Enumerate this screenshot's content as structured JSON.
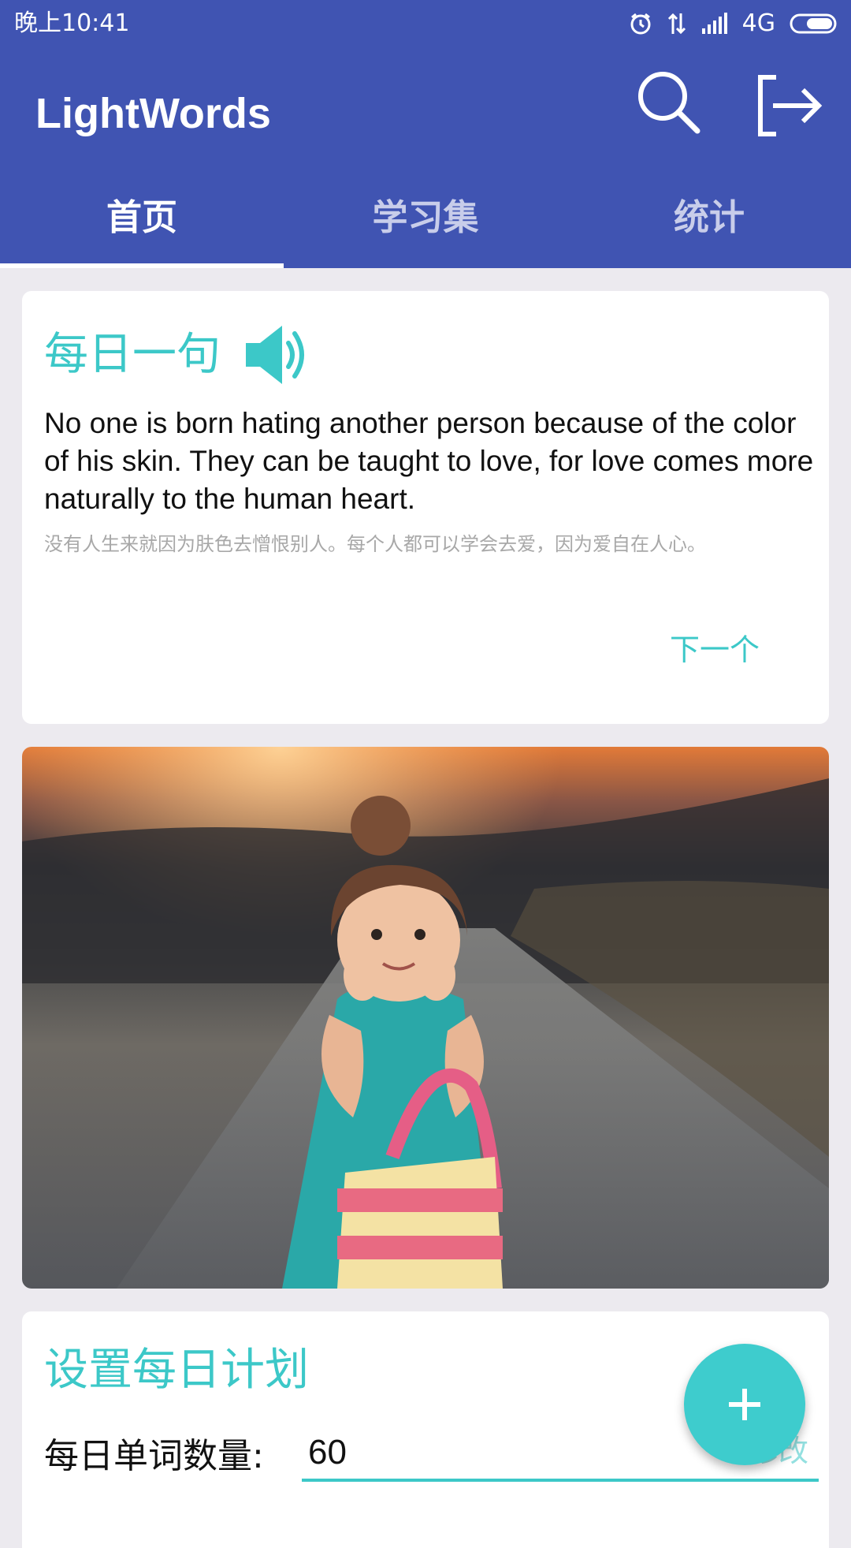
{
  "status_bar": {
    "time": "晚上10:41",
    "network": "4G",
    "icons": [
      "alarm-icon",
      "data-transfer-icon",
      "signal-icon",
      "battery-icon"
    ]
  },
  "app_bar": {
    "title": "LightWords",
    "actions": [
      "search-icon",
      "exit-icon"
    ],
    "background_color": "#4054B2"
  },
  "tabs": [
    {
      "label": "首页",
      "active": true
    },
    {
      "label": "学习集",
      "active": false
    },
    {
      "label": "统计",
      "active": false
    }
  ],
  "daily_sentence": {
    "title": "每日一句",
    "speaker_icon": "speaker-icon",
    "english": "No one is born hating another person because of the color of his skin. They can be taught to love, for love comes more naturally to the human heart.",
    "chinese": "没有人生来就因为肤色去憎恨别人。每个人都可以学会去爱，因为爱自在人心。",
    "next_label": "下一个",
    "accent_color": "#3CC8C8"
  },
  "photo": {
    "description_icon": "photo-image"
  },
  "daily_plan": {
    "title": "设置每日计划",
    "word_count_label": "每日单词数量:",
    "word_count_value": "60",
    "modify_label": "修改"
  },
  "fab": {
    "icon": "plus-icon",
    "color": "#3ECCCD"
  }
}
